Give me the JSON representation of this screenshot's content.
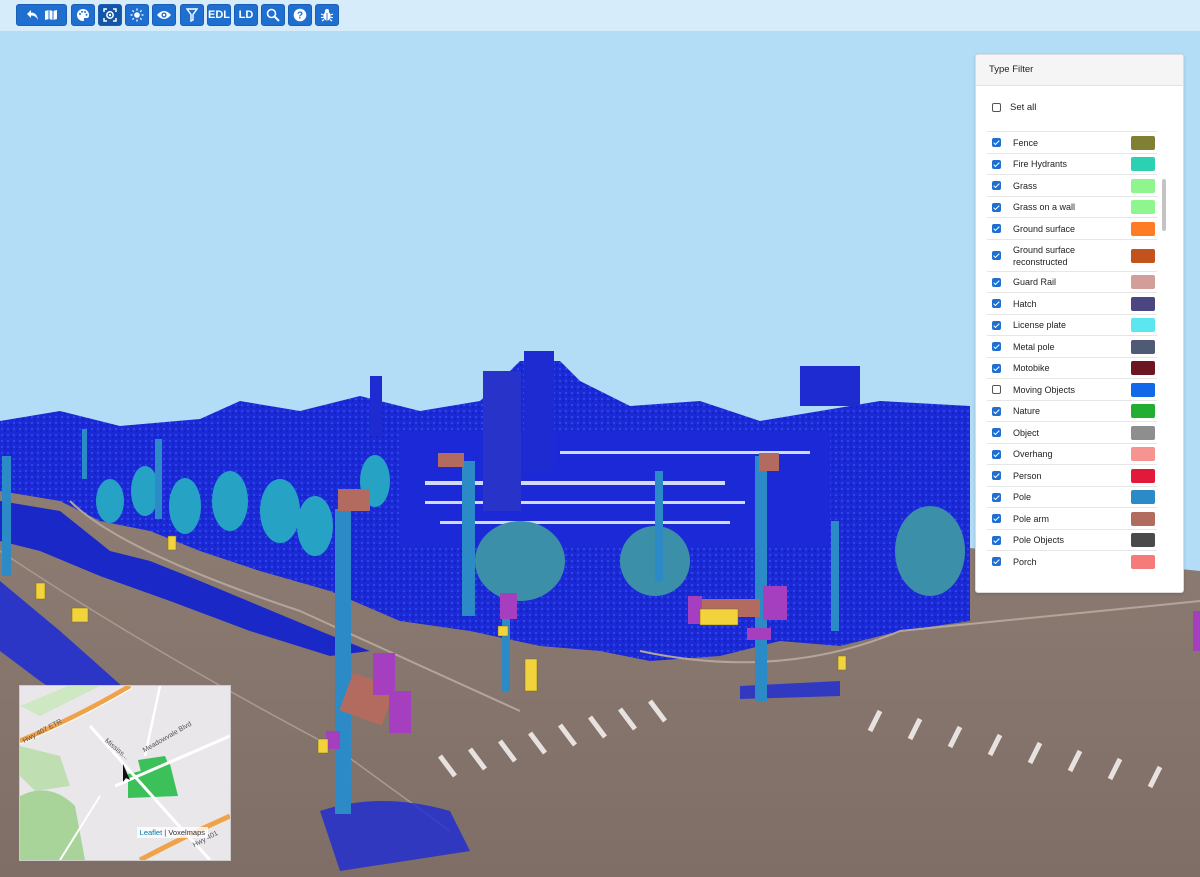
{
  "toolbar": {
    "buttons": [
      {
        "name": "back-map-button",
        "icon": "back-map-icon"
      },
      {
        "name": "palette-button",
        "icon": "palette-icon"
      },
      {
        "name": "focus-button",
        "icon": "focus-icon"
      },
      {
        "name": "brightness-button",
        "icon": "sun-icon"
      },
      {
        "name": "visibility-button",
        "icon": "eye-icon"
      },
      {
        "name": "filter-button",
        "icon": "filter-icon"
      },
      {
        "name": "edl-button",
        "label": "EDL"
      },
      {
        "name": "ld-button",
        "label": "LD"
      },
      {
        "name": "search-button",
        "icon": "search-icon"
      },
      {
        "name": "help-button",
        "icon": "help-icon"
      },
      {
        "name": "bug-button",
        "icon": "bug-icon"
      }
    ],
    "edl_label": "EDL",
    "ld_label": "LD",
    "colors": {
      "bar": "#d6ecfb",
      "button": "#1f6fd1"
    }
  },
  "type_filter": {
    "title": "Type Filter",
    "set_all_label": "Set all",
    "set_all_checked": false,
    "items": [
      {
        "label": "Fence",
        "checked": true,
        "color": "#808035"
      },
      {
        "label": "Fire Hydrants",
        "checked": true,
        "color": "#2bd1b0"
      },
      {
        "label": "Grass",
        "checked": true,
        "color": "#8ff58f"
      },
      {
        "label": "Grass on a wall",
        "checked": true,
        "color": "#8ff58f"
      },
      {
        "label": "Ground surface",
        "checked": true,
        "color": "#fe7c24"
      },
      {
        "label": "Ground surface reconstructed",
        "checked": true,
        "color": "#c3531c"
      },
      {
        "label": "Guard Rail",
        "checked": true,
        "color": "#d39e9a"
      },
      {
        "label": "Hatch",
        "checked": true,
        "color": "#4b4582"
      },
      {
        "label": "License plate",
        "checked": true,
        "color": "#5ce6f0"
      },
      {
        "label": "Metal pole",
        "checked": true,
        "color": "#4f5a75"
      },
      {
        "label": "Motobike",
        "checked": true,
        "color": "#6e1523"
      },
      {
        "label": "Moving Objects",
        "checked": false,
        "color": "#1168e9"
      },
      {
        "label": "Nature",
        "checked": true,
        "color": "#22ad33"
      },
      {
        "label": "Object",
        "checked": true,
        "color": "#8e8e8e"
      },
      {
        "label": "Overhang",
        "checked": true,
        "color": "#f69491"
      },
      {
        "label": "Person",
        "checked": true,
        "color": "#e3193b"
      },
      {
        "label": "Pole",
        "checked": true,
        "color": "#2c8ac7"
      },
      {
        "label": "Pole arm",
        "checked": true,
        "color": "#b36b5f"
      },
      {
        "label": "Pole Objects",
        "checked": true,
        "color": "#4a4a4a"
      },
      {
        "label": "Porch",
        "checked": true,
        "color": "#f57a7a"
      }
    ]
  },
  "minimap": {
    "labels": {
      "hwy407": "Hwy 407 ETR",
      "meadowvale": "Meadowvale Blvd",
      "mississauga": "Mississ...",
      "hwy401": "Hwy 401"
    },
    "attribution": {
      "leaflet": "Leaflet",
      "sep": " | ",
      "voxelmaps": "Voxelmaps"
    }
  },
  "scene": {
    "sky_color": "#b3dcf7",
    "pointcloud_color": "#1b2ad6",
    "road_color": "#8d7e76"
  }
}
